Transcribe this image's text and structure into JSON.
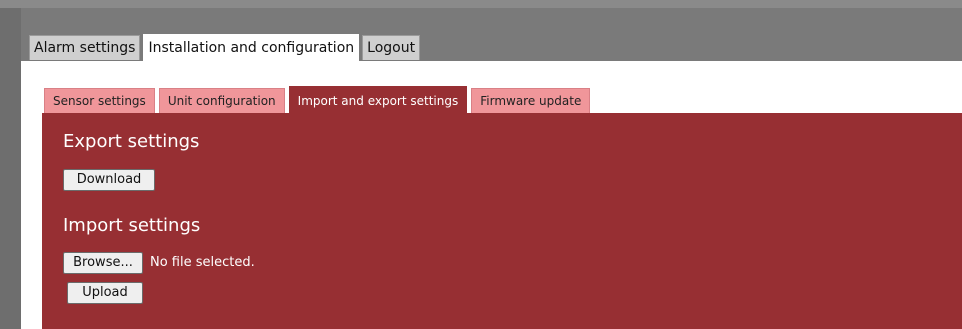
{
  "main_tabs": [
    {
      "label": "Alarm settings"
    },
    {
      "label": "Installation and configuration"
    },
    {
      "label": "Logout"
    }
  ],
  "sub_tabs": [
    {
      "label": "Sensor settings"
    },
    {
      "label": "Unit configuration"
    },
    {
      "label": "Import and export settings"
    },
    {
      "label": "Firmware update"
    }
  ],
  "export": {
    "title": "Export settings",
    "download_label": "Download"
  },
  "import": {
    "title": "Import settings",
    "browse_label": "Browse...",
    "file_status": "No file selected.",
    "upload_label": "Upload"
  },
  "colors": {
    "panel_red": "#972f33",
    "tab_pink": "#f0969a",
    "frame_gray": "#7a7a7a"
  }
}
